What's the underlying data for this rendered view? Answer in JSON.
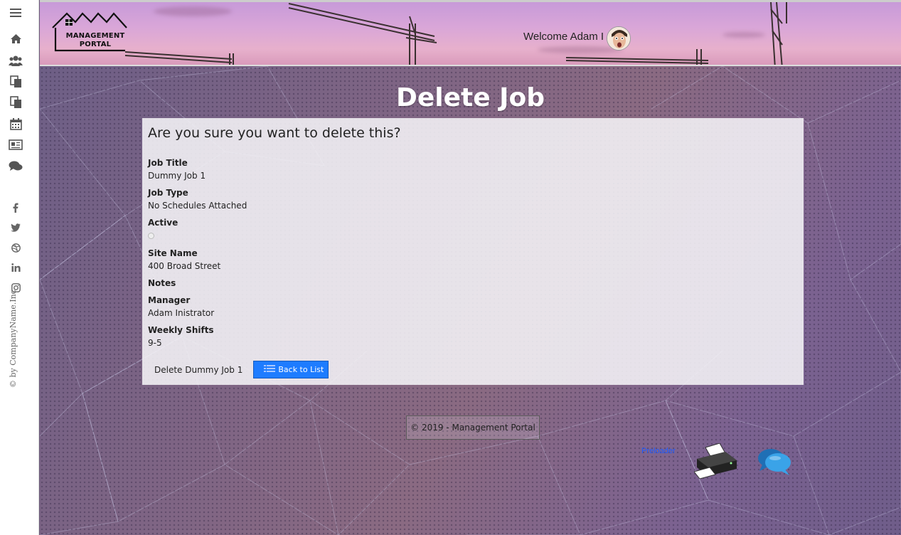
{
  "header": {
    "logo_text_line1": "MANAGEMENT",
    "logo_text_line2": "PORTAL",
    "welcome": "Welcome Adam I"
  },
  "sidebar": {
    "nav_icons": [
      "menu-icon",
      "home-icon",
      "users-icon",
      "documents-icon",
      "copy-icon",
      "calendar-icon",
      "newspaper-icon",
      "comments-icon"
    ],
    "social_icons": [
      "facebook-icon",
      "twitter-icon",
      "dribbble-icon",
      "linkedin-icon",
      "instagram-icon"
    ],
    "copyright": "© by CompanyName.Inc"
  },
  "page": {
    "title": "Delete Job",
    "confirm": "Are you sure you want to delete this?",
    "fields": [
      {
        "label": "Job Title",
        "value": "Dummy Job 1"
      },
      {
        "label": "Job Type",
        "value": "No Schedules Attached"
      },
      {
        "label": "Active",
        "value": ""
      },
      {
        "label": "Site Name",
        "value": "400 Broad Street"
      },
      {
        "label": "Notes",
        "value": ""
      },
      {
        "label": "Manager",
        "value": "Adam Inistrator"
      },
      {
        "label": "Weekly Shifts",
        "value": "9-5"
      }
    ],
    "delete_button": "Delete Dummy Job 1",
    "back_button": "Back to List"
  },
  "footer": {
    "copyright": "© 2019 - Management Portal",
    "preloader": "Preloader"
  },
  "colors": {
    "accent": "#1e7cff",
    "title": "#ffffff"
  }
}
